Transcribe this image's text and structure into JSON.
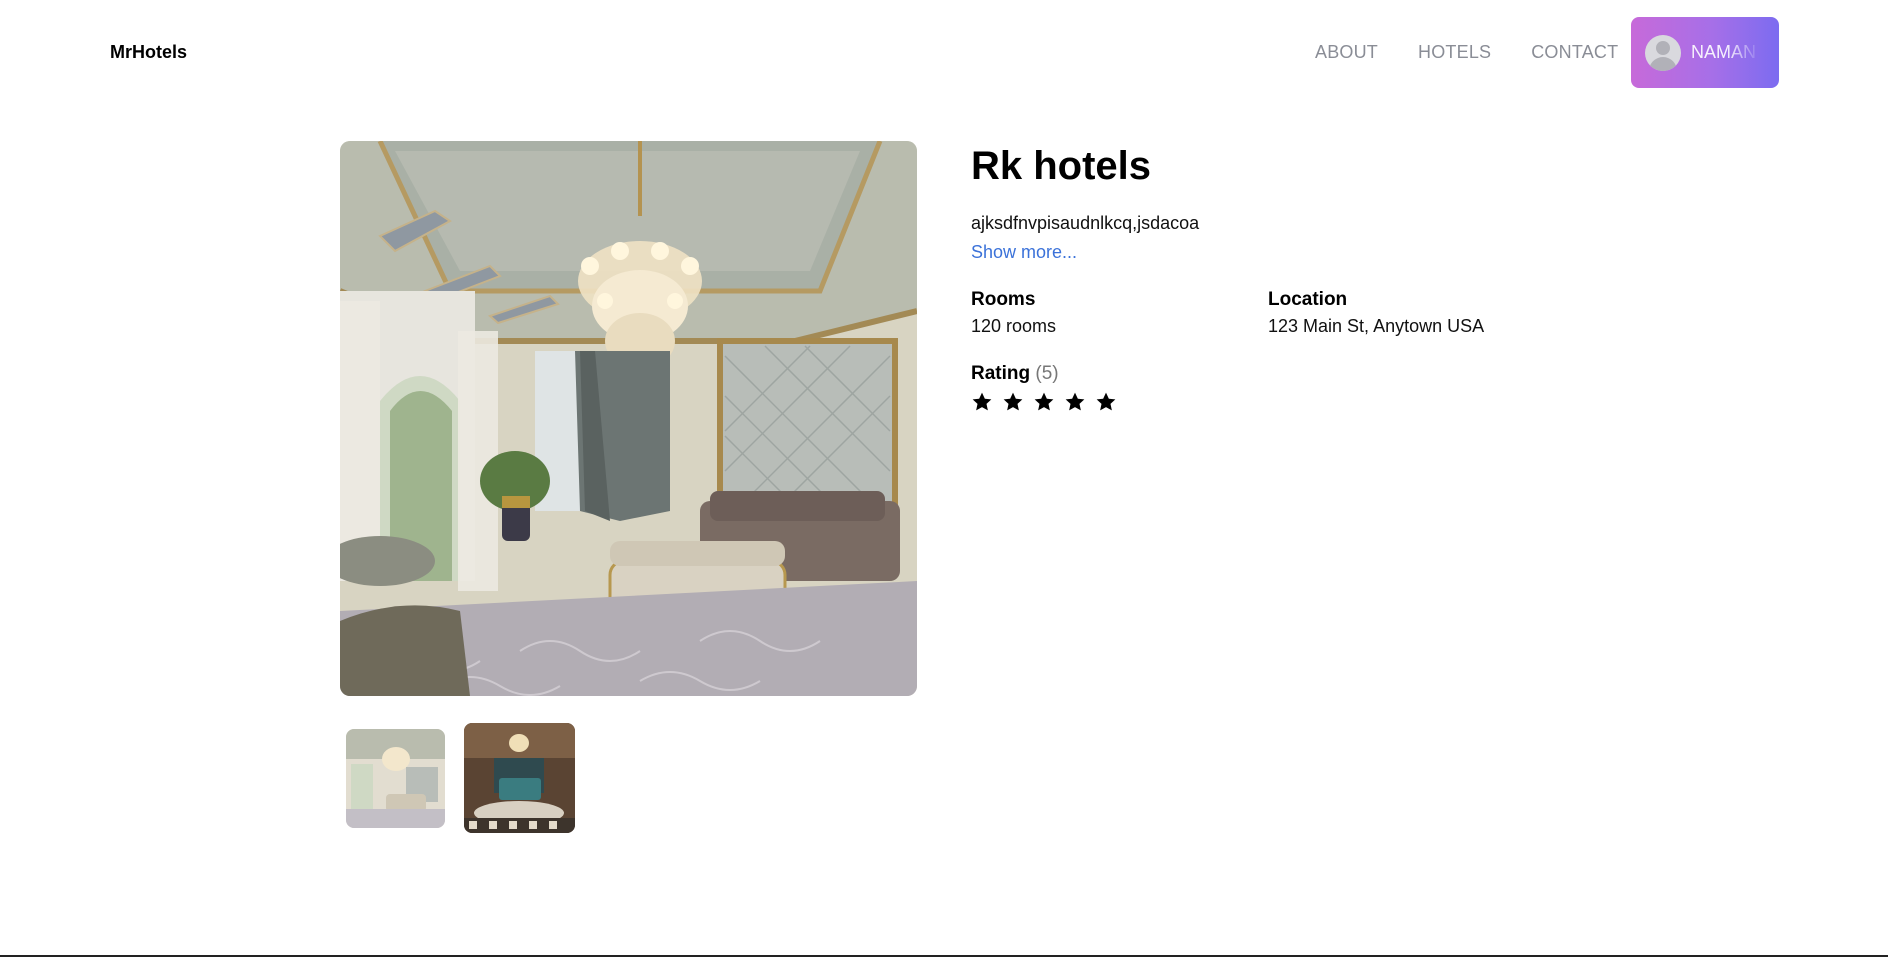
{
  "header": {
    "brand": "MrHotels",
    "nav": [
      "ABOUT",
      "HOTELS",
      "CONTACT"
    ],
    "user_name": "NAMAN"
  },
  "hotel": {
    "name": "Rk hotels",
    "description": "ajksdfnvpisaudnlkcq,jsdacoa",
    "show_more": "Show more...",
    "rooms_label": "Rooms",
    "rooms_value": "120 rooms",
    "location_label": "Location",
    "location_value": "123 Main St, Anytown USA",
    "rating_label": "Rating",
    "rating_count": "(5)",
    "stars": 5
  },
  "colors": {
    "accent_gradient_start": "#c76ad9",
    "accent_gradient_end": "#7c6cf0",
    "link": "#3b72d9",
    "nav_text": "#8a8d96"
  },
  "icons": {
    "avatar": "user-avatar-icon",
    "star": "star-icon"
  }
}
